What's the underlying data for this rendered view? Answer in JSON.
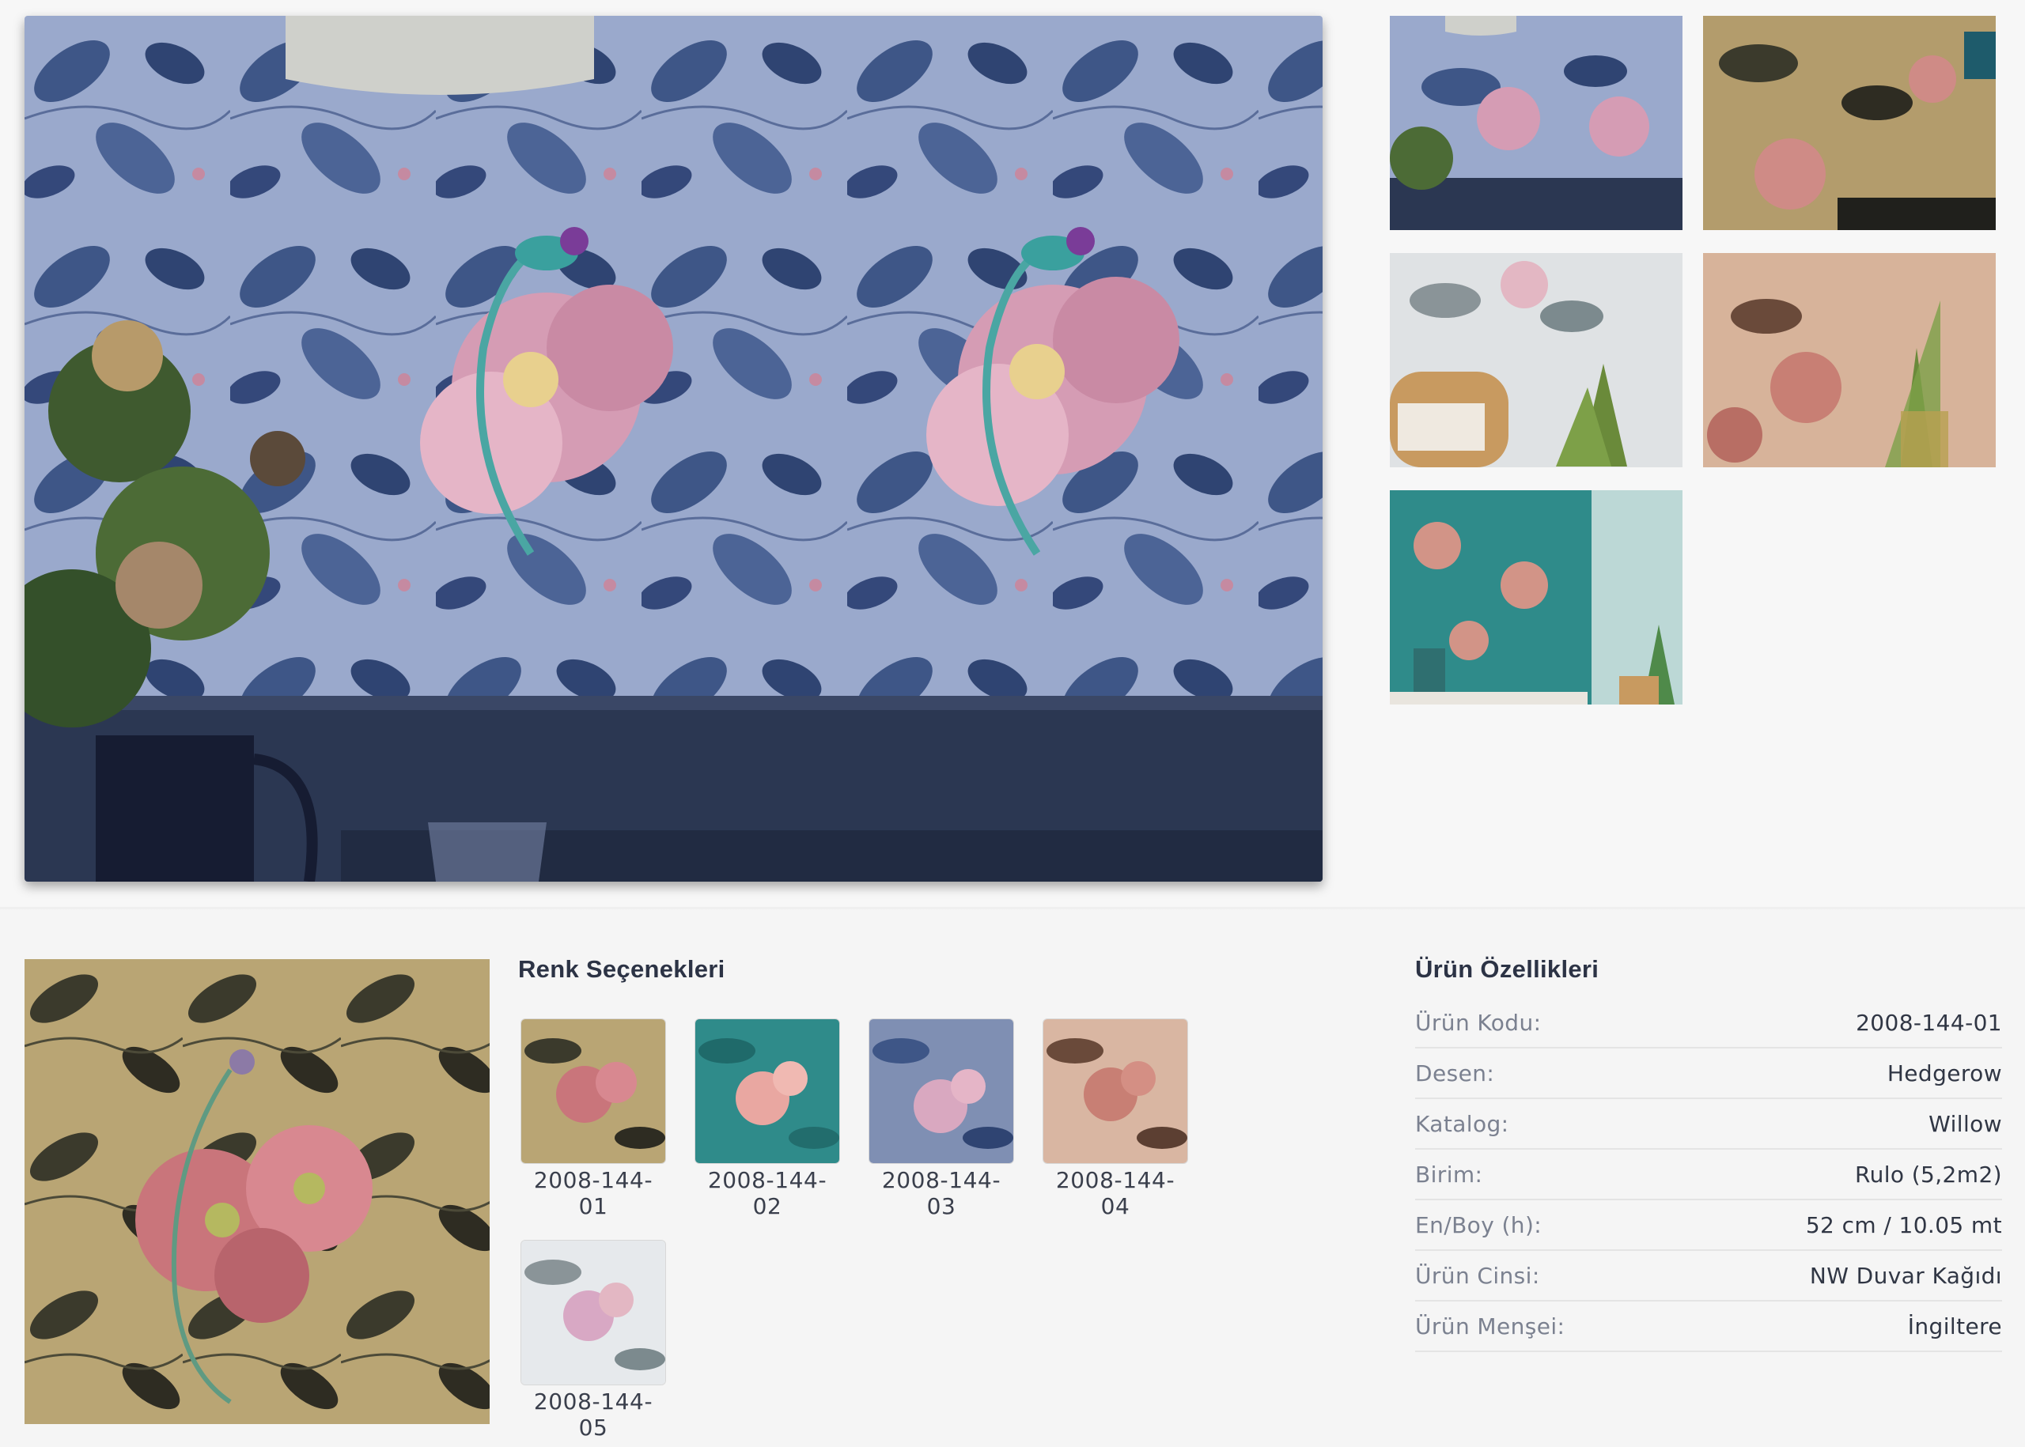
{
  "gallery": {
    "main_image": "wallpaper-room-blue-hedgerow",
    "thumbnails": [
      {
        "name": "thumbnail-blue-room"
      },
      {
        "name": "thumbnail-gold-room"
      },
      {
        "name": "thumbnail-white-bedroom"
      },
      {
        "name": "thumbnail-peach-vase"
      },
      {
        "name": "thumbnail-teal-room"
      }
    ]
  },
  "color_options": {
    "title": "Renk Seçenekleri",
    "items": [
      {
        "code": "2008-144-01",
        "color": "#b9a574"
      },
      {
        "code": "2008-144-02",
        "color": "#2f8b8a"
      },
      {
        "code": "2008-144-03",
        "color": "#7f8fb3"
      },
      {
        "code": "2008-144-04",
        "color": "#d9b6a2"
      },
      {
        "code": "2008-144-05",
        "color": "#e6e9ec"
      }
    ]
  },
  "specs": {
    "title": "Ürün Özellikleri",
    "rows": [
      {
        "key": "Ürün Kodu:",
        "value": "2008-144-01"
      },
      {
        "key": "Desen:",
        "value": "Hedgerow"
      },
      {
        "key": "Katalog:",
        "value": "Willow"
      },
      {
        "key": "Birim:",
        "value": "Rulo (5,2m2)"
      },
      {
        "key": "En/Boy (h):",
        "value": "52 cm / 10.05 mt"
      },
      {
        "key": "Ürün Cinsi:",
        "value": "NW Duvar Kağıdı"
      },
      {
        "key": "Ürün Menşei:",
        "value": "İngiltere"
      }
    ]
  }
}
